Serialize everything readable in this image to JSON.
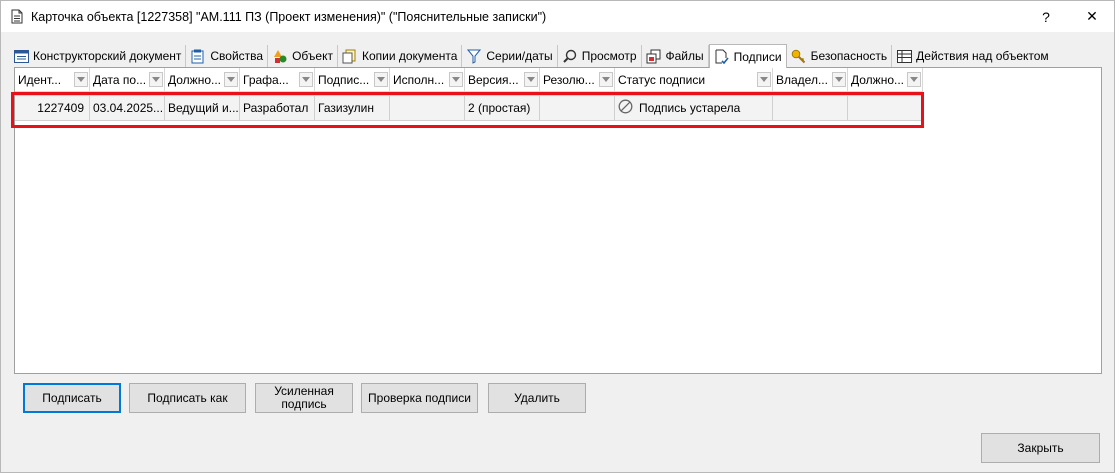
{
  "window": {
    "title": "Карточка объекта [1227358] \"АМ.111 ПЗ (Проект изменения)\" (\"Пояснительные записки\")",
    "help_label": "?",
    "close_label": "✕"
  },
  "tabs": [
    {
      "label": "Конструкторский документ",
      "icon": "document-list-icon"
    },
    {
      "label": "Свойства",
      "icon": "properties-icon"
    },
    {
      "label": "Объект",
      "icon": "shapes-icon"
    },
    {
      "label": "Копии документа",
      "icon": "copies-icon"
    },
    {
      "label": "Серии/даты",
      "icon": "filter-icon"
    },
    {
      "label": "Просмотр",
      "icon": "magnifier-icon"
    },
    {
      "label": "Файлы",
      "icon": "files-icon"
    },
    {
      "label": "Подписи",
      "icon": "signature-icon",
      "active": true
    },
    {
      "label": "Безопасность",
      "icon": "key-icon"
    },
    {
      "label": "Действия над объектом",
      "icon": "table-icon"
    }
  ],
  "table": {
    "columns": [
      "Идент...",
      "Дата по...",
      "Должно...",
      "Графа...",
      "Подпис...",
      "Исполн...",
      "Версия...",
      "Резолю...",
      "Статус подписи",
      "Владел...",
      "Должно..."
    ],
    "rows": [
      {
        "cells": [
          "1227409",
          "03.04.2025...",
          "Ведущий и...",
          "Разработал",
          "Газизулин",
          "",
          "2 (простая)",
          "",
          "Подпись устарела",
          "",
          ""
        ],
        "status_icon": "prohibited-icon"
      }
    ]
  },
  "buttons": {
    "sign": "Подписать",
    "sign_as": "Подписать как",
    "enhanced": "Усиленная подпись",
    "verify": "Проверка подписи",
    "delete": "Удалить",
    "close": "Закрыть"
  },
  "colors": {
    "highlight": "#e8101a",
    "primary_border": "#0078d7"
  }
}
